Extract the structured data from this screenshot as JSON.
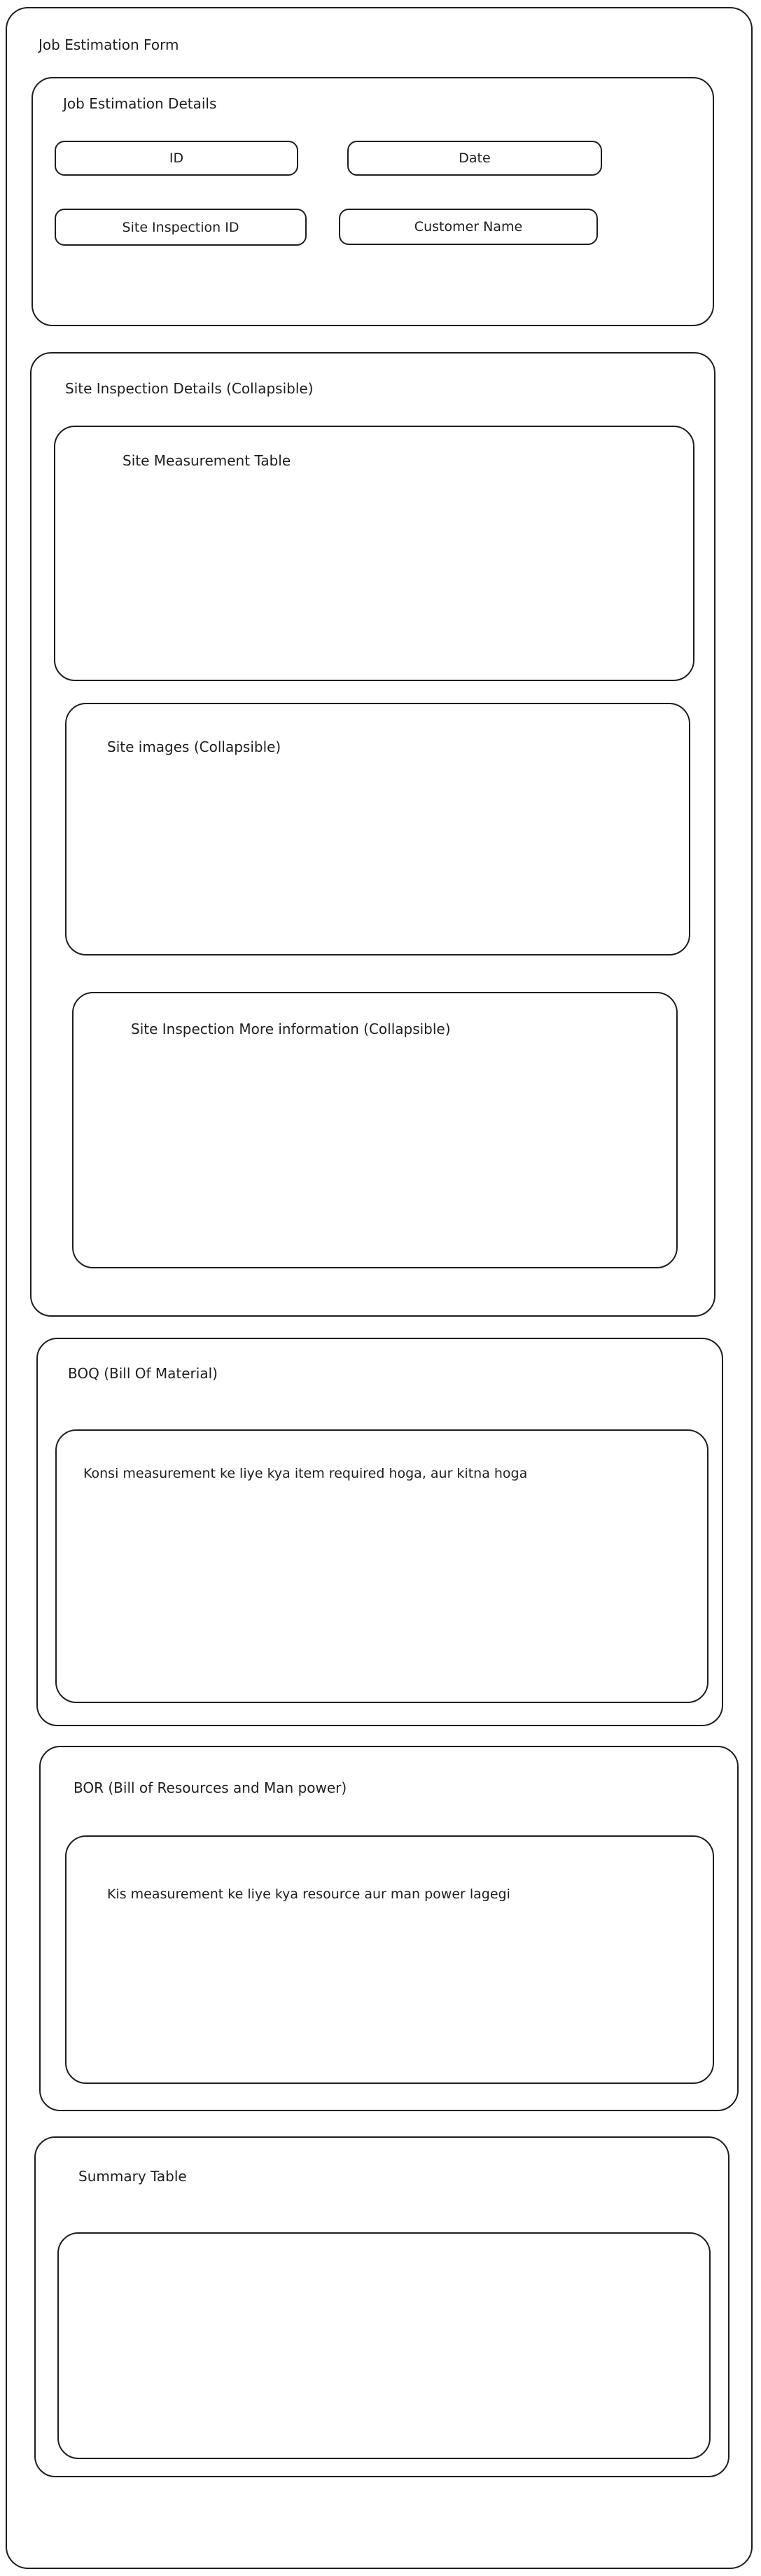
{
  "form": {
    "title": "Job Estimation Form"
  },
  "job_details": {
    "heading": "Job Estimation Details",
    "fields": {
      "id": "ID",
      "date": "Date",
      "site_inspection_id": "Site Inspection ID",
      "customer_name": "Customer Name"
    }
  },
  "site_inspection": {
    "heading": "Site Inspection Details (Collapsible)",
    "measurement_table": "Site Measurement Table",
    "images": "Site images (Collapsible)",
    "more_info": "Site Inspection More information (Collapsible)"
  },
  "boq": {
    "heading": "BOQ (Bill Of Material)",
    "note": "Konsi measurement ke liye kya item required hoga, aur kitna hoga"
  },
  "bor": {
    "heading": "BOR (Bill of Resources and Man power)",
    "note": "Kis measurement ke liye kya resource aur man power lagegi"
  },
  "summary": {
    "heading": "Summary Table"
  }
}
